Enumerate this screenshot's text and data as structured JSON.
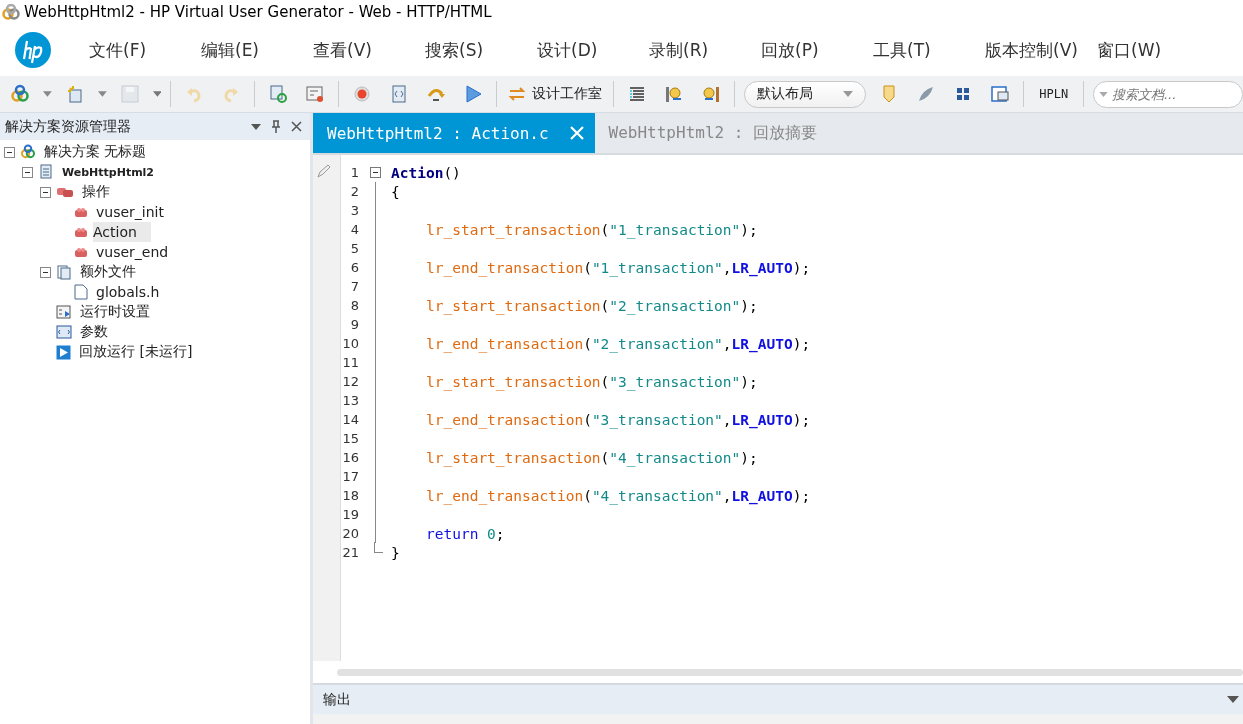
{
  "window": {
    "title": "WebHttpHtml2 - HP Virtual User Generator - Web - HTTP/HTML"
  },
  "menu": [
    "文件(F)",
    "编辑(E)",
    "查看(V)",
    "搜索(S)",
    "设计(D)",
    "录制(R)",
    "回放(P)",
    "工具(T)",
    "版本控制(V)",
    "窗口(W)"
  ],
  "toolbar": {
    "design_studio": "设计工作室",
    "layout": "默认布局",
    "hpln": "HPLN",
    "search": {
      "placeholder": "搜索文档..."
    }
  },
  "explorer": {
    "title": "解决方案资源管理器",
    "tree": [
      {
        "label": "解决方案 无标题",
        "kind": "solution",
        "expanded": true,
        "selected": false,
        "children": [
          {
            "label": "WebHttpHtml2",
            "kind": "script",
            "expanded": true,
            "selected": false,
            "children": [
              {
                "label": "操作",
                "kind": "actions",
                "expanded": true,
                "selected": false,
                "children": [
                  {
                    "label": "vuser_init",
                    "kind": "action",
                    "selected": false
                  },
                  {
                    "label": "Action",
                    "kind": "action",
                    "selected": true
                  },
                  {
                    "label": "vuser_end",
                    "kind": "action",
                    "selected": false
                  }
                ]
              },
              {
                "label": "额外文件",
                "kind": "files",
                "expanded": true,
                "selected": false,
                "children": [
                  {
                    "label": "globals.h",
                    "kind": "file",
                    "selected": false
                  }
                ]
              },
              {
                "label": "运行时设置",
                "kind": "settings",
                "selected": false
              },
              {
                "label": "参数",
                "kind": "params",
                "selected": false
              },
              {
                "label": "回放运行 [未运行]",
                "kind": "replay",
                "selected": false
              }
            ]
          }
        ]
      }
    ]
  },
  "tabs": [
    {
      "label": "WebHttpHtml2 : Action.c",
      "selected": true
    },
    {
      "label": "WebHttpHtml2 : 回放摘要",
      "selected": false
    }
  ],
  "code": [
    {
      "number": "1",
      "indented": false,
      "tokens": [
        {
          "kind": "decl",
          "text": "Action"
        },
        {
          "kind": "plain",
          "text": "()"
        }
      ]
    },
    {
      "number": "2",
      "indented": false,
      "tokens": [
        {
          "kind": "plain",
          "text": "{"
        }
      ]
    },
    {
      "number": "3"
    },
    {
      "number": "4",
      "indented": true,
      "tokens": [
        {
          "kind": "func",
          "text": "lr_start_transaction"
        },
        {
          "kind": "plain",
          "text": "("
        },
        {
          "kind": "str",
          "text": "\"1_transaction\""
        },
        {
          "kind": "plain",
          "text": ");"
        }
      ]
    },
    {
      "number": "5"
    },
    {
      "number": "6",
      "indented": true,
      "tokens": [
        {
          "kind": "func",
          "text": "lr_end_transaction"
        },
        {
          "kind": "plain",
          "text": "("
        },
        {
          "kind": "str",
          "text": "\"1_transaction\""
        },
        {
          "kind": "plain",
          "text": ","
        },
        {
          "kind": "kw",
          "text": "LR_AUTO"
        },
        {
          "kind": "plain",
          "text": ");"
        }
      ]
    },
    {
      "number": "7"
    },
    {
      "number": "8",
      "indented": true,
      "tokens": [
        {
          "kind": "func",
          "text": "lr_start_transaction"
        },
        {
          "kind": "plain",
          "text": "("
        },
        {
          "kind": "str",
          "text": "\"2_transaction\""
        },
        {
          "kind": "plain",
          "text": ");"
        }
      ]
    },
    {
      "number": "9"
    },
    {
      "number": "10",
      "indented": true,
      "tokens": [
        {
          "kind": "func",
          "text": "lr_end_transaction"
        },
        {
          "kind": "plain",
          "text": "("
        },
        {
          "kind": "str",
          "text": "\"2_transaction\""
        },
        {
          "kind": "plain",
          "text": ","
        },
        {
          "kind": "kw",
          "text": "LR_AUTO"
        },
        {
          "kind": "plain",
          "text": ");"
        }
      ]
    },
    {
      "number": "11"
    },
    {
      "number": "12",
      "indented": true,
      "tokens": [
        {
          "kind": "func",
          "text": "lr_start_transaction"
        },
        {
          "kind": "plain",
          "text": "("
        },
        {
          "kind": "str",
          "text": "\"3_transaction\""
        },
        {
          "kind": "plain",
          "text": ");"
        }
      ]
    },
    {
      "number": "13"
    },
    {
      "number": "14",
      "indented": true,
      "tokens": [
        {
          "kind": "func",
          "text": "lr_end_transaction"
        },
        {
          "kind": "plain",
          "text": "("
        },
        {
          "kind": "str",
          "text": "\"3_transaction\""
        },
        {
          "kind": "plain",
          "text": ","
        },
        {
          "kind": "kw",
          "text": "LR_AUTO"
        },
        {
          "kind": "plain",
          "text": ");"
        }
      ]
    },
    {
      "number": "15"
    },
    {
      "number": "16",
      "indented": true,
      "tokens": [
        {
          "kind": "func",
          "text": "lr_start_transaction"
        },
        {
          "kind": "plain",
          "text": "("
        },
        {
          "kind": "str",
          "text": "\"4_transaction\""
        },
        {
          "kind": "plain",
          "text": ");"
        }
      ]
    },
    {
      "number": "17"
    },
    {
      "number": "18",
      "indented": true,
      "tokens": [
        {
          "kind": "func",
          "text": "lr_end_transaction"
        },
        {
          "kind": "plain",
          "text": "("
        },
        {
          "kind": "str",
          "text": "\"4_transaction\""
        },
        {
          "kind": "plain",
          "text": ","
        },
        {
          "kind": "kw",
          "text": "LR_AUTO"
        },
        {
          "kind": "plain",
          "text": ");"
        }
      ]
    },
    {
      "number": "19"
    },
    {
      "number": "20",
      "indented": true,
      "tokens": [
        {
          "kind": "kw2",
          "text": "return"
        },
        {
          "kind": "num",
          "text": " 0"
        },
        {
          "kind": "plain",
          "text": ";"
        }
      ]
    },
    {
      "number": "21",
      "indented": false,
      "tokens": [
        {
          "kind": "plain",
          "text": "}"
        }
      ]
    }
  ],
  "output": {
    "title": "输出"
  }
}
